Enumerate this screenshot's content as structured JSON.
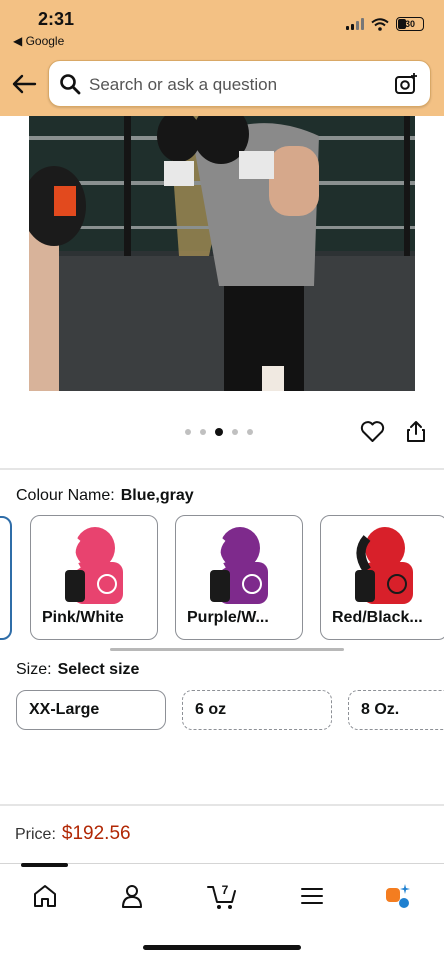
{
  "status": {
    "time": "2:31",
    "back_app": "◀ Google",
    "battery": "30"
  },
  "search": {
    "placeholder": "Search or ask a question"
  },
  "gallery": {
    "dot_count": 5,
    "active_dot_index": 2
  },
  "variation": {
    "colour_label": "Colour Name:",
    "colour_value": "Blue,gray",
    "swatches": [
      {
        "label": "Pink/White",
        "glove_color": "#e8436f"
      },
      {
        "label": "Purple/W...",
        "glove_color": "#7e2a8c"
      },
      {
        "label": "Red/Black...",
        "glove_color": "#d8202a"
      }
    ],
    "size_label": "Size:",
    "size_value": "Select size",
    "sizes": [
      "XX-Large",
      "6 oz",
      "8 Oz."
    ]
  },
  "price": {
    "label": "Price:",
    "value": "$192.56"
  },
  "nav": {
    "cart_count": "7",
    "items": [
      "home",
      "account",
      "cart",
      "menu",
      "rufus"
    ]
  },
  "colors": {
    "header_bg": "#f3c184",
    "price": "#b12704",
    "selected_border": "#2f6da8"
  }
}
